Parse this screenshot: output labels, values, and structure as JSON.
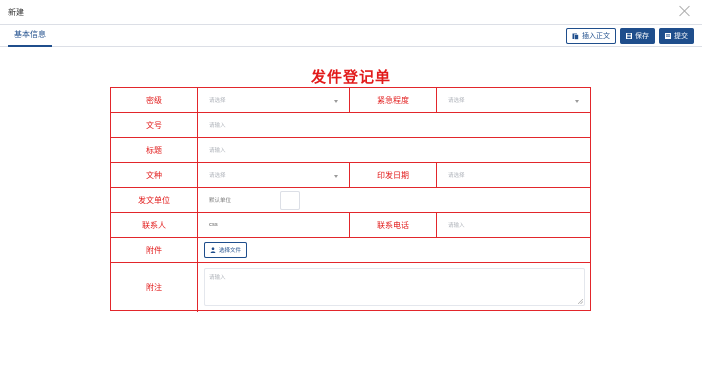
{
  "window": {
    "title": "新建"
  },
  "tabs": [
    {
      "label": "基本信息"
    }
  ],
  "toolbar": {
    "insert_label": "插入正文",
    "save_label": "保存",
    "submit_label": "提交"
  },
  "form": {
    "title": "发件登记单",
    "labels": {
      "secret_level": "密级",
      "urgency": "紧急程度",
      "doc_number": "文号",
      "subject": "标题",
      "doc_type": "文种",
      "print_date": "印发日期",
      "issuing_unit": "发文单位",
      "contact": "联系人",
      "phone": "联系电话",
      "attachment": "附件",
      "remarks": "附注"
    },
    "fields": {
      "secret_level_placeholder": "请选择",
      "urgency_placeholder": "请选择",
      "doc_number_placeholder": "请输入",
      "subject_placeholder": "请输入",
      "doc_type_placeholder": "请选择",
      "print_date_placeholder": "请选择",
      "issuing_unit_value": "默认单位",
      "contact_value": "css",
      "phone_placeholder": "请输入",
      "attachment_button": "选择文件",
      "remarks_placeholder": "请输入"
    }
  },
  "colors": {
    "accent": "#1f4e8c",
    "form_red": "#e21b1b"
  }
}
